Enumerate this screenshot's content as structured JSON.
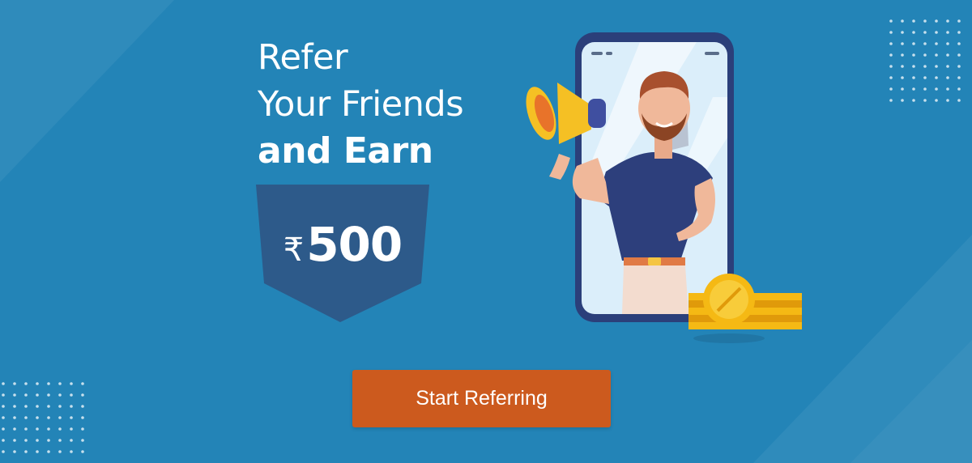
{
  "headline": {
    "line1": "Refer",
    "line2": "Your Friends",
    "line3": "and Earn"
  },
  "reward": {
    "currency_symbol": "₹",
    "amount": "500"
  },
  "cta": {
    "label": "Start Referring"
  },
  "colors": {
    "background": "#2384b7",
    "badge": "#2d5a8a",
    "button": "#cc5a1e",
    "coin": "#f5b914"
  },
  "icons": [
    "megaphone-icon",
    "coin-icon",
    "rupee-icon"
  ]
}
